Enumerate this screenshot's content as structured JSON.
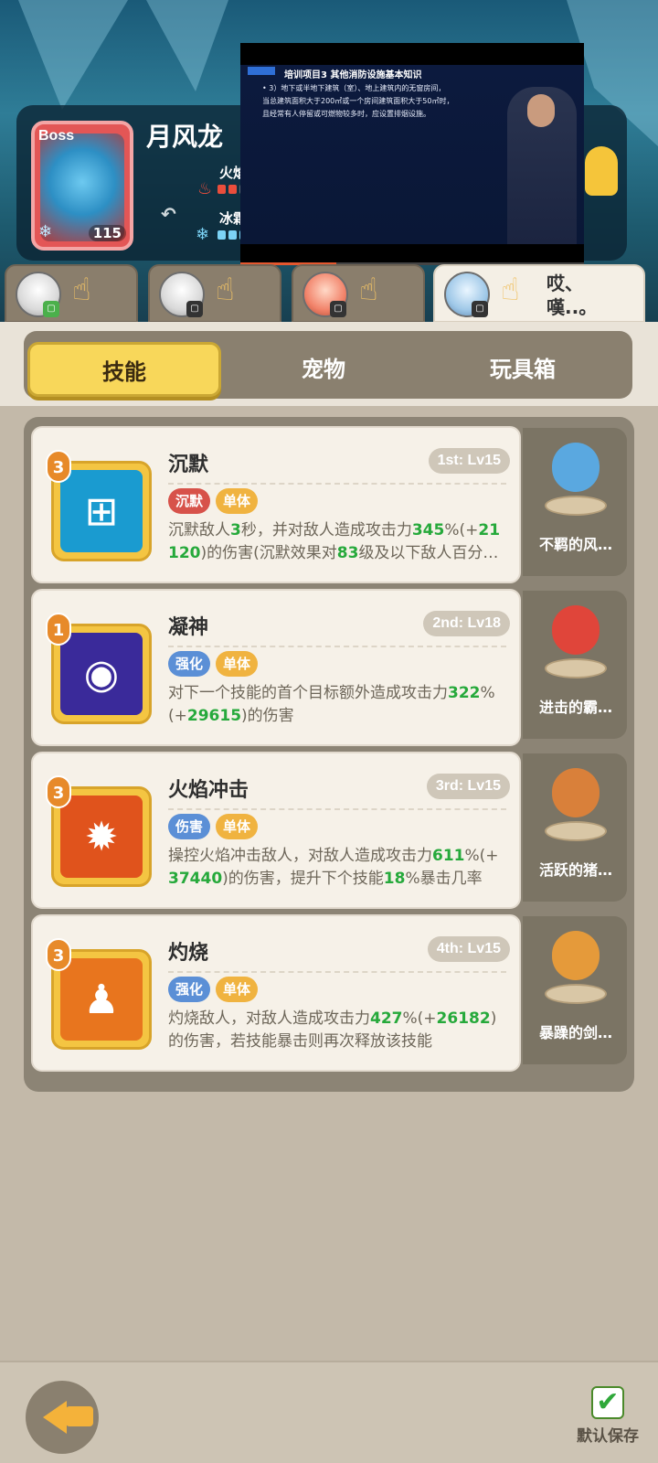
{
  "boss": {
    "tag": "Boss",
    "name": "月风龙",
    "level": "115",
    "element_icon": "snowflake-fire-icon",
    "stats": [
      {
        "label": "火焰",
        "filled": 2,
        "total": 5,
        "color": "#e94e3c"
      },
      {
        "label": "冰霜",
        "filled": 3,
        "total": 5,
        "color": "#7bd3f5"
      }
    ]
  },
  "video": {
    "title": "培训项目3   其他消防设施基本知识",
    "lines": [
      "• 3）地下或半地下建筑（室）、地上建筑内的无窗房间，",
      "当总建筑面积大于200㎡或一个房间建筑面积大于50㎡时，",
      "且经常有人停留或可燃物较多时，应设置排烟设施。"
    ],
    "progress": 0.28
  },
  "heroes": [
    {
      "name": "hero-1",
      "badge": "chat-icon",
      "avatar": "gray",
      "active": false
    },
    {
      "name": "hero-2",
      "badge": "chat-icon",
      "avatar": "gray",
      "active": false
    },
    {
      "name": "hero-3",
      "badge": "chat-icon",
      "avatar": "red",
      "active": false
    },
    {
      "name": "hero-4",
      "badge": "chat-icon",
      "avatar": "blue",
      "active": true,
      "dialog": "哎、嘆..。"
    }
  ],
  "tabs": [
    {
      "label": "技能",
      "active": true
    },
    {
      "label": "宠物",
      "active": false
    },
    {
      "label": "玩具箱",
      "active": false
    }
  ],
  "skills": [
    {
      "num": "3",
      "name": "沉默",
      "level": "1st: Lv15",
      "tags": [
        {
          "label": "沉默",
          "color": "red"
        },
        {
          "label": "单体",
          "color": "yellow"
        }
      ],
      "desc_html": "沉默敌人<b>3</b>秒，并对敌人造成攻击力<b>345</b>%(+<b>21120</b>)的伤害(沉默效果对<b>83</b>级及以下敌人百分…",
      "icon": "silence-cube-icon",
      "icon_bg": "#1a9bd0",
      "pet": "不羁的风…",
      "pet_color": "#5aa8e0"
    },
    {
      "num": "1",
      "name": "凝神",
      "level": "2nd: Lv18",
      "tags": [
        {
          "label": "强化",
          "color": "blue"
        },
        {
          "label": "单体",
          "color": "yellow"
        }
      ],
      "desc_html": "对下一个技能的首个目标额外造成攻击力<b>322</b>%(+<b>29615</b>)的伤害",
      "icon": "focus-eye-icon",
      "icon_bg": "#3a2a9a",
      "pet": "进击的霸…",
      "pet_color": "#e0453a"
    },
    {
      "num": "3",
      "name": "火焰冲击",
      "level": "3rd: Lv15",
      "tags": [
        {
          "label": "伤害",
          "color": "blue"
        },
        {
          "label": "单体",
          "color": "yellow"
        }
      ],
      "desc_html": "操控火焰冲击敌人，对敌人造成攻击力<b>611</b>%(+<b>37440</b>)的伤害，提升下个技能<b>18</b>%暴击几率",
      "icon": "flame-burst-icon",
      "icon_bg": "#e0531c",
      "pet": "活跃的猪…",
      "pet_color": "#d9803a"
    },
    {
      "num": "3",
      "name": "灼烧",
      "level": "4th: Lv15",
      "tags": [
        {
          "label": "强化",
          "color": "blue"
        },
        {
          "label": "单体",
          "color": "yellow"
        }
      ],
      "desc_html": "灼烧敌人，对敌人造成攻击力<b>427</b>%(+<b>26182</b>)的伤害，若技能暴击则再次释放该技能",
      "icon": "burn-figure-icon",
      "icon_bg": "#e8751e",
      "pet": "暴躁的剑…",
      "pet_color": "#e59a3a"
    }
  ],
  "bottom": {
    "save_label": "默认保存"
  }
}
